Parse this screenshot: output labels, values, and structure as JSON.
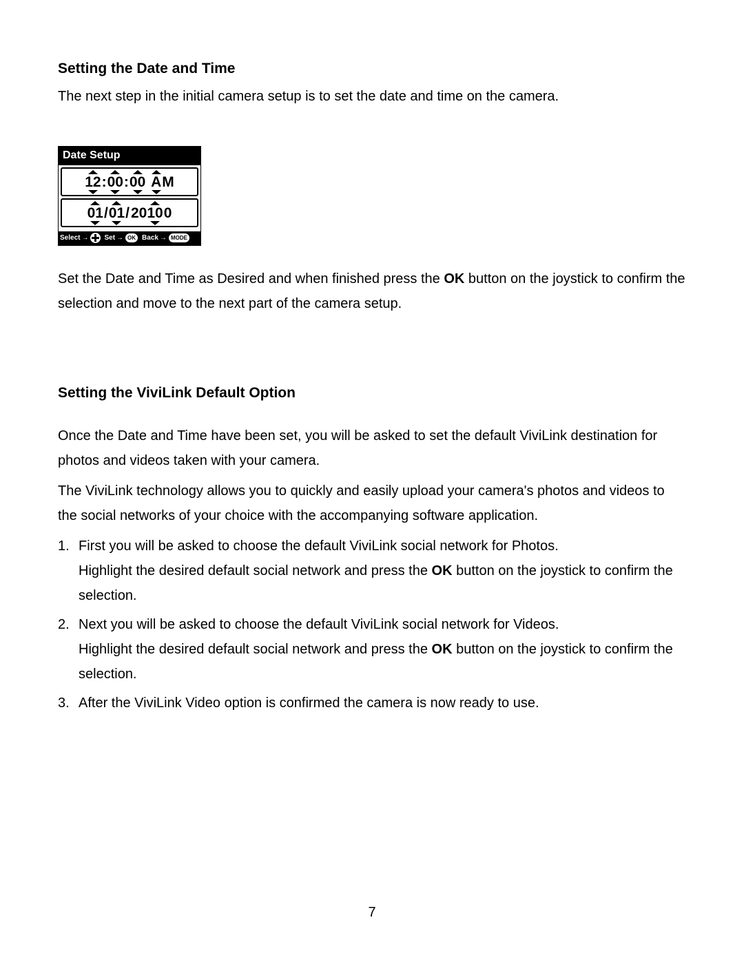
{
  "page_number": "7",
  "section1": {
    "heading": "Setting the Date and Time",
    "intro": "The next step in the initial camera setup is to set the date and time on the camera.",
    "para_pre": "Set the Date and Time as Desired and when finished press the ",
    "para_bold": "OK",
    "para_post": " button on the joystick to confirm the selection and move to the next part of the camera setup."
  },
  "lcd": {
    "title": "Date Setup",
    "time": {
      "hh": "12",
      "mm": "00",
      "ss": "00",
      "ampm_first": "A",
      "ampm_rest": "M",
      "sep": ":"
    },
    "date": {
      "mm": "01",
      "dd": "01",
      "yy": "10",
      "century": "20",
      "sep": "/"
    },
    "hints": {
      "select_label": "Select",
      "set_label": "Set",
      "back_label": "Back",
      "ok_label": "OK",
      "mode_label": "MODE"
    }
  },
  "section2": {
    "heading": "Setting the ViviLink Default Option",
    "p1": "Once the Date and Time have been set, you will be asked to set the default ViviLink destination for photos and videos taken with your camera.",
    "p2": "The ViviLink technology allows you to quickly and easily upload your camera's photos and videos to the social networks of your choice with the accompanying software application.",
    "items": [
      {
        "num": "1.",
        "line1": "First you will be asked to choose the default ViviLink social network for Photos.",
        "line2_pre": "Highlight the desired default social network and press the ",
        "line2_bold": "OK",
        "line2_post": " button on the joystick to confirm the selection."
      },
      {
        "num": "2.",
        "line1": "Next you will be asked to choose the default ViviLink social network for Videos.",
        "line2_pre": "Highlight the desired default social network and press the ",
        "line2_bold": "OK",
        "line2_post": " button on the joystick to confirm the selection."
      },
      {
        "num": "3.",
        "line1": "After the ViviLink Video option is confirmed the camera is now ready to use."
      }
    ]
  }
}
